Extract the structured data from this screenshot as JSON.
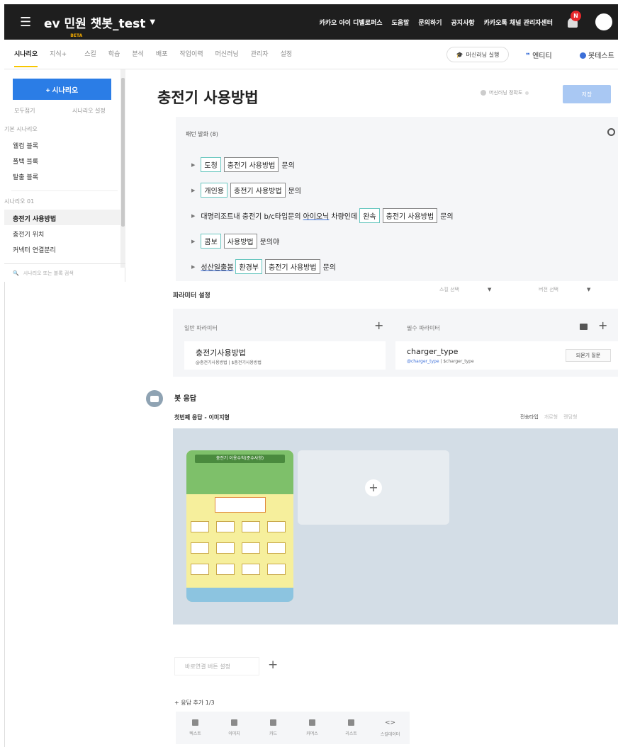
{
  "topbar": {
    "bot_name": "ev 민원 챗봇_test",
    "links": [
      "카카오 아이 디벨로퍼스",
      "도움말",
      "문의하기",
      "공지사항",
      "카카오톡 채널 관리자센터"
    ],
    "notification_badge": "N"
  },
  "nav": {
    "tabs": [
      "시나리오",
      "지식+",
      "스킬",
      "학습",
      "분석",
      "배포",
      "작업이력",
      "머신러닝",
      "관리자",
      "설정"
    ],
    "beta_label": "BETA",
    "ml_run": "머신러닝 실행",
    "entity": "엔티티",
    "bot_test": "봇테스트"
  },
  "sidebar": {
    "add_button": "+ 시나리오",
    "collapse_all": "모두접기",
    "scenario_settings": "시나리오 설정",
    "group_default": "기본 시나리오",
    "default_items": [
      "웰컴 블록",
      "폴백 블록",
      "탈출 블록"
    ],
    "group_01": "시나리오 01",
    "items": [
      "충전기 사용방법",
      "충전기 위치",
      "커넥터 연결분리"
    ],
    "search_placeholder": "시나리오 또는 블록 검색"
  },
  "main": {
    "title": "충전기 사용방법",
    "ml_accuracy": "머신러닝 정확도",
    "save": "저장",
    "patterns_title": "패턴 발화 (8)",
    "utterances": [
      [
        {
          "t": "도청",
          "k": "g"
        },
        {
          "t": "충전기 사용방법",
          "k": "d"
        },
        {
          "t": "문의",
          "k": "p"
        }
      ],
      [
        {
          "t": "개인용",
          "k": "g"
        },
        {
          "t": "충전기 사용방법",
          "k": "d"
        },
        {
          "t": "문의",
          "k": "p"
        }
      ],
      [
        {
          "t": "대명리조트내 충전기 b/c타입문의",
          "k": "p"
        },
        {
          "t": "아이오닉",
          "k": "u"
        },
        {
          "t": "차량인데",
          "k": "p"
        },
        {
          "t": "완속",
          "k": "g"
        },
        {
          "t": "충전기 사용방법",
          "k": "d"
        },
        {
          "t": "문의",
          "k": "p"
        }
      ],
      [
        {
          "t": "콤보",
          "k": "g"
        },
        {
          "t": "사용방법",
          "k": "d"
        },
        {
          "t": "문의야",
          "k": "p"
        }
      ],
      [
        {
          "t": "성산일출봉",
          "k": "u"
        },
        {
          "t": "환경부",
          "k": "g"
        },
        {
          "t": "충전기 사용방법",
          "k": "d"
        },
        {
          "t": "문의",
          "k": "p"
        }
      ]
    ],
    "param_settings": "파라미터 설정",
    "skill_select": "스킬 선택",
    "version_select": "버전 선택",
    "general_params": "일반 파라미터",
    "required_params": "필수 파라미터",
    "general_param": {
      "name": "충전기사용방법",
      "entity": "@충전기사용방법",
      "value": "$충전기사용방법"
    },
    "required_param": {
      "name": "charger_type",
      "entity": "@charger_type",
      "value": "$charger_type",
      "reask": "되묻기 질문"
    },
    "bot_reply": "봇 응답",
    "first_reply": "첫번째 응답 - 이미지형",
    "send_type": "전송타입",
    "send_type_opt1": "개로형",
    "send_type_opt2": "랜덤형",
    "poster_title": "충전기 이용수칙(준수사항)",
    "quick_reply": "바로연결 버튼 설정",
    "add_reply": "+ 응답 추가 1/3",
    "reply_types": [
      "텍스트",
      "이미지",
      "카드",
      "커머스",
      "리스트",
      "스킬데이터"
    ]
  },
  "colors": {
    "accent": "#2b7de6",
    "tab_underline": "#f7c600",
    "entity_green": "#6ac7c0",
    "topbar": "#1e1e1e"
  },
  "icons": [
    "hamburger-icon",
    "bell-icon",
    "search-icon",
    "folder-icon",
    "plus-icon",
    "bot-icon",
    "mortarboard-icon"
  ]
}
